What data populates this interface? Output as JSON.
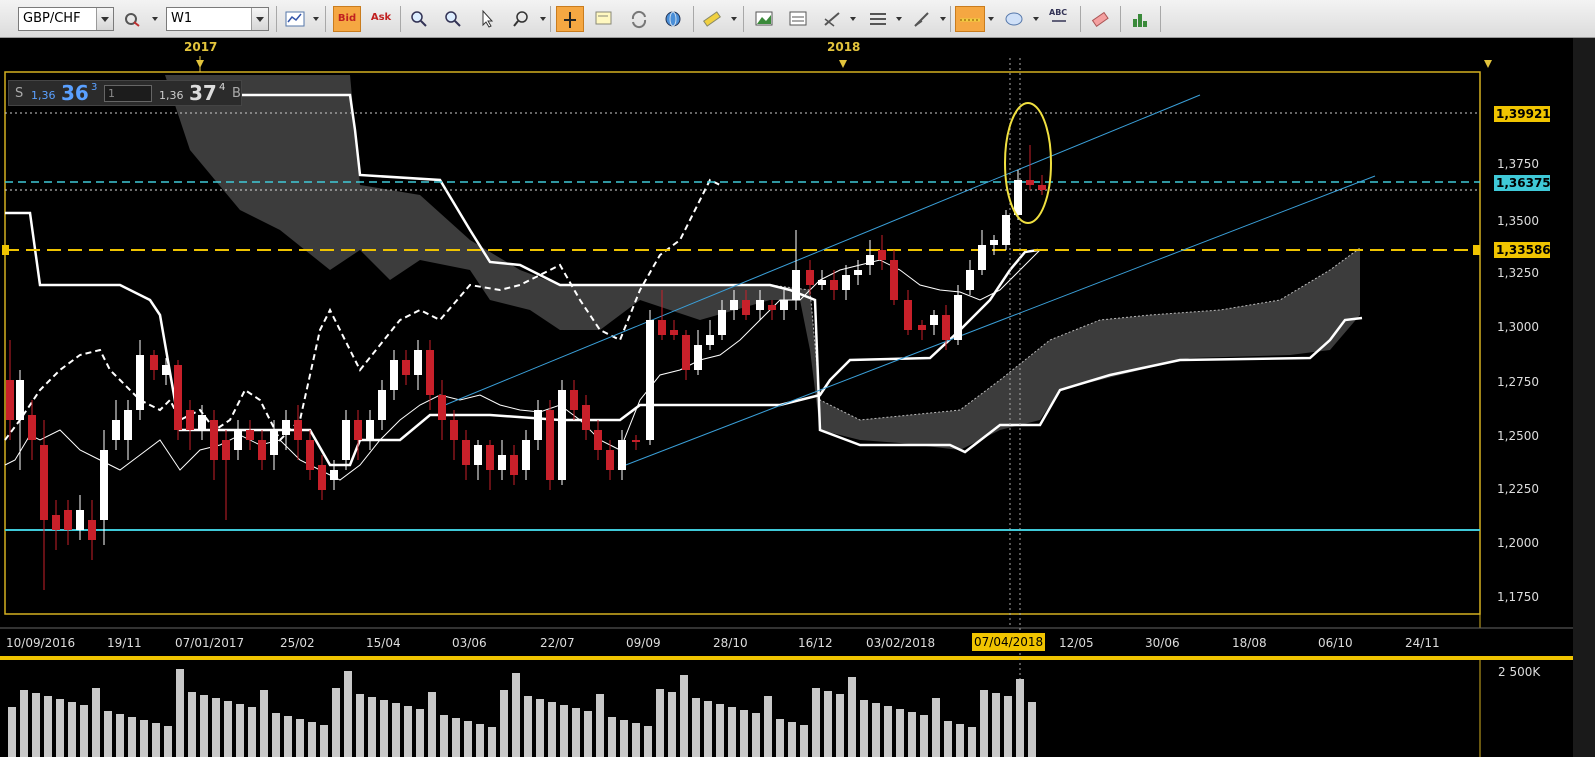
{
  "toolbar": {
    "symbol": "GBP/CHF",
    "timeframe": "W1",
    "bid_label": "Bid",
    "ask_label": "Ask",
    "abc_label": "ABC",
    "icons": [
      "refresh-icon",
      "clear-icon",
      "chart-type-icon",
      "zoom-in-icon",
      "zoom-out-icon",
      "cursor-icon",
      "zoom-tool-icon",
      "crosshair-icon",
      "annotate-icon",
      "sync-icon",
      "globe-icon",
      "ruler-icon",
      "image-icon",
      "template-icon",
      "draw-line-icon",
      "levels-icon",
      "pen-icon",
      "horizontal-line-icon",
      "shape-icon",
      "text-icon",
      "eraser-icon",
      "indicators-icon"
    ]
  },
  "years": [
    "2017",
    "2018"
  ],
  "price_panel": {
    "sell_label": "S",
    "sell_small": "1,36",
    "sell_big": "36",
    "sell_sup": "3",
    "quantity": "1",
    "buy_small": "1,36",
    "buy_big": "37",
    "buy_sup": "4",
    "buy_label": "B"
  },
  "price_axis": [
    "1,3750",
    "1,3500",
    "1,3250",
    "1,3000",
    "1,2750",
    "1,2500",
    "1,2250",
    "1,2000",
    "1,1750"
  ],
  "price_tags": {
    "top": "1,39921",
    "current": "1,36375",
    "support": "1,33586"
  },
  "dates": [
    "10/09/2016",
    "19/11",
    "07/01/2017",
    "25/02",
    "15/04",
    "03/06",
    "22/07",
    "09/09",
    "28/10",
    "16/12",
    "03/02/2018",
    "07/04/2018",
    "12/05",
    "30/06",
    "18/08",
    "06/10",
    "24/11"
  ],
  "volume_label": "2 500K",
  "colors": {
    "bull": "#ffffff",
    "bear": "#c8202a",
    "accent": "#f0c400",
    "cyan": "#3fc9d8",
    "channel": "#3a9fd8"
  }
}
